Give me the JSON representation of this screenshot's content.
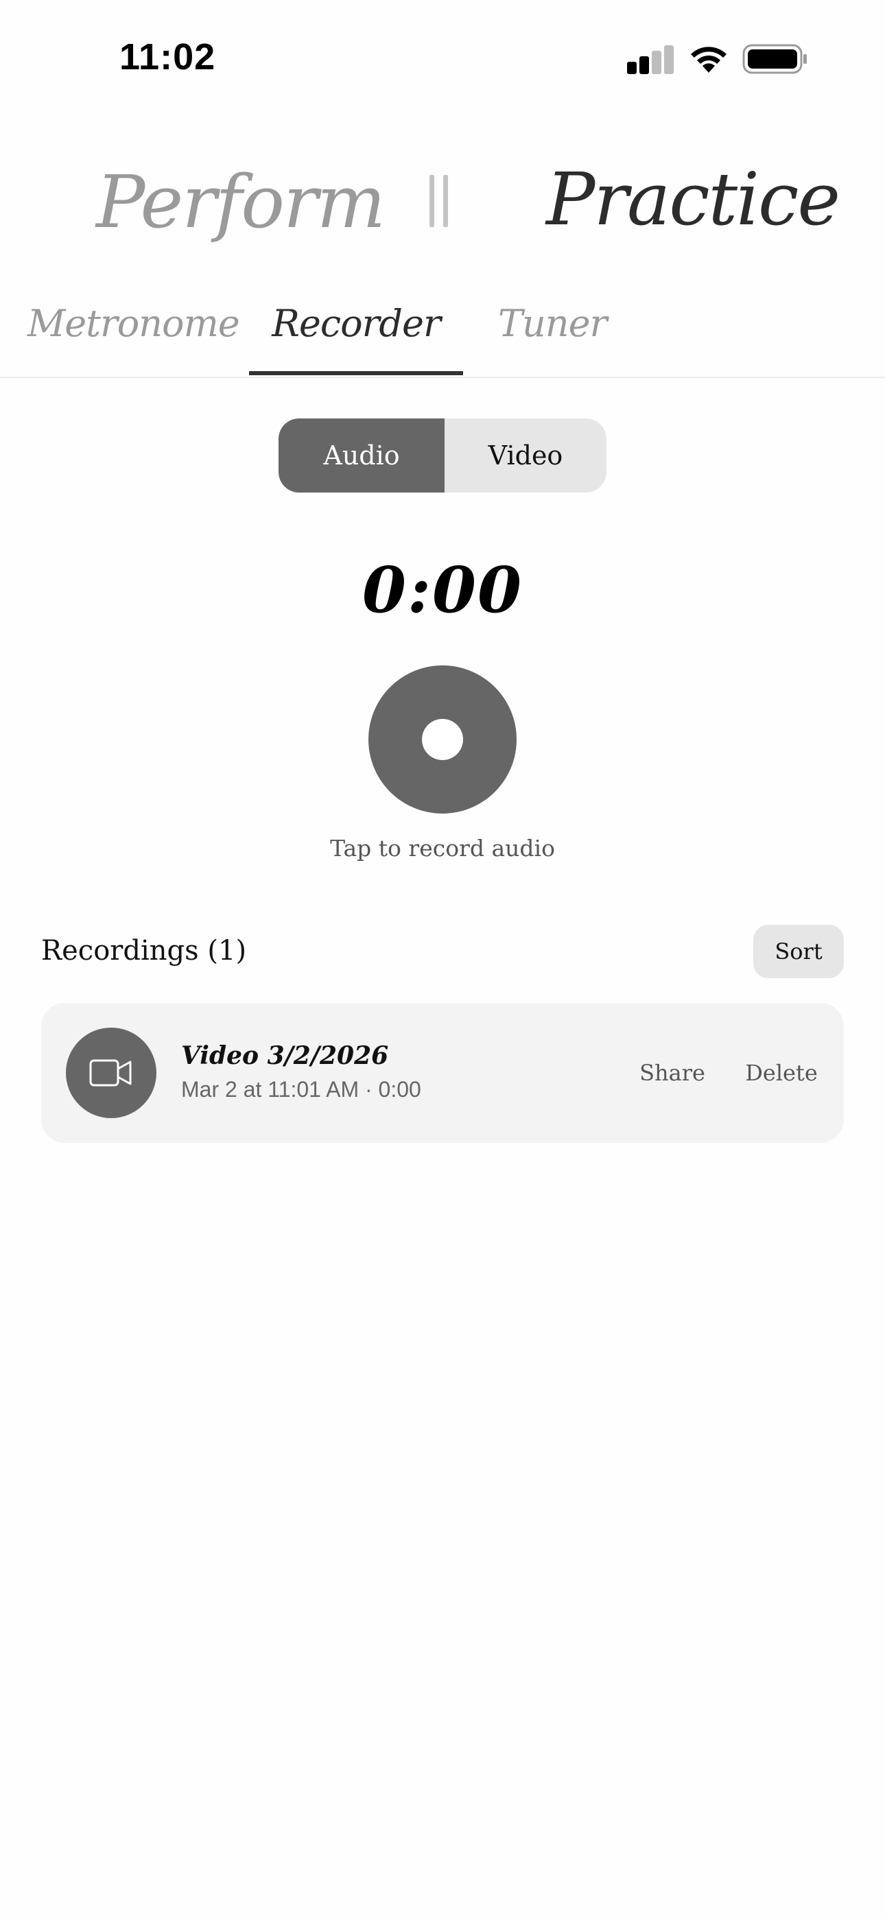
{
  "status_bar": {
    "time": "11:02",
    "icons": [
      "cellular-signal-icon",
      "wifi-icon",
      "battery-icon"
    ]
  },
  "mode": {
    "perform_label": "Perform",
    "practice_label": "Practice",
    "active": "Practice"
  },
  "tabs": {
    "items": [
      {
        "label": "Metronome",
        "active": false
      },
      {
        "label": "Recorder",
        "active": true
      },
      {
        "label": "Tuner",
        "active": false
      }
    ]
  },
  "recorder": {
    "segments": [
      {
        "label": "Audio",
        "selected": true
      },
      {
        "label": "Video",
        "selected": false
      }
    ],
    "timer": "0:00",
    "hint": "Tap to record audio"
  },
  "recordings": {
    "title": "Recordings (1)",
    "sort_label": "Sort",
    "items": [
      {
        "name": "Video 3/2/2026",
        "meta": "Mar 2 at 11:01 AM · 0:00",
        "icon": "video-camera-icon",
        "share_label": "Share",
        "delete_label": "Delete"
      }
    ]
  },
  "colors": {
    "accent_gray": "#666666",
    "muted_text": "#9a9a9a",
    "dark_text": "#2c2c2c",
    "card_bg": "#f3f3f3",
    "segment_bg": "#e6e6e6"
  }
}
